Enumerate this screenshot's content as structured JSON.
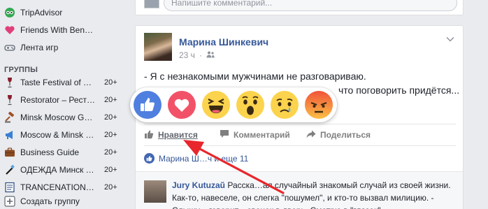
{
  "sidebar": {
    "items_top": [
      {
        "label": "TripAdvisor",
        "icon": "owl-icon"
      },
      {
        "label": "Friends With Benef…",
        "icon": "heart-icon"
      },
      {
        "label": "Лента игр",
        "icon": "gamepad-icon"
      }
    ],
    "groups_heading": "ГРУППЫ",
    "groups": [
      {
        "label": "Taste Festival of M…",
        "count": "20+",
        "icon": "wine-glass-icon"
      },
      {
        "label": "Restorator – Рест…",
        "count": "20+",
        "icon": "wine-glass-icon"
      },
      {
        "label": "Minsk Moscow Gu…",
        "count": "20+",
        "icon": "gavel-icon"
      },
      {
        "label": "Moscow & Minsk …",
        "count": "20+",
        "icon": "megaphone-icon"
      },
      {
        "label": "Business Guide",
        "count": "20+",
        "icon": "briefcase-icon"
      },
      {
        "label": "ОДЕЖДА Минск В…",
        "count": "20+",
        "icon": "hanger-icon"
      },
      {
        "label": "TRANCENATION…",
        "count": "20+",
        "icon": "document-icon"
      }
    ],
    "create_group": "Создать группу"
  },
  "top_card": {
    "comment_placeholder": "Напишите комментарий..."
  },
  "post": {
    "author": "Марина Шинкевич",
    "time": "23 ч",
    "text_line1": "- Я с незнакомыми мужчинами не разговариваю.",
    "text_line2": "что поговорить придётся...",
    "text_line3": "-",
    "actions": {
      "like": "Нравится",
      "comment": "Комментарий",
      "share": "Поделиться"
    },
    "likes_summary": "Марина Ш…ч и еще 11",
    "comment": {
      "author": "Jury Kutuzaŭ",
      "text": "Расска…ал случайный знакомый случай из своей жизни. Как-то, навеселе, он слегка \"пошумел\", и кто-то вызвал милицию. - Слышу, - говорит, - звонок в дверь. Смотрю в \"глазок\" -"
    }
  },
  "reactions": [
    {
      "name": "like",
      "color": "#4267b2"
    },
    {
      "name": "love",
      "color": "#f25268"
    },
    {
      "name": "haha",
      "color": "#fcd34d"
    },
    {
      "name": "wow",
      "color": "#fcd34d"
    },
    {
      "name": "sad",
      "color": "#fcd34d"
    },
    {
      "name": "angry",
      "color": "#f27b4f"
    }
  ],
  "colors": {
    "link": "#365899",
    "background": "#e9ebee",
    "annotation_arrow": "#e8262b"
  }
}
